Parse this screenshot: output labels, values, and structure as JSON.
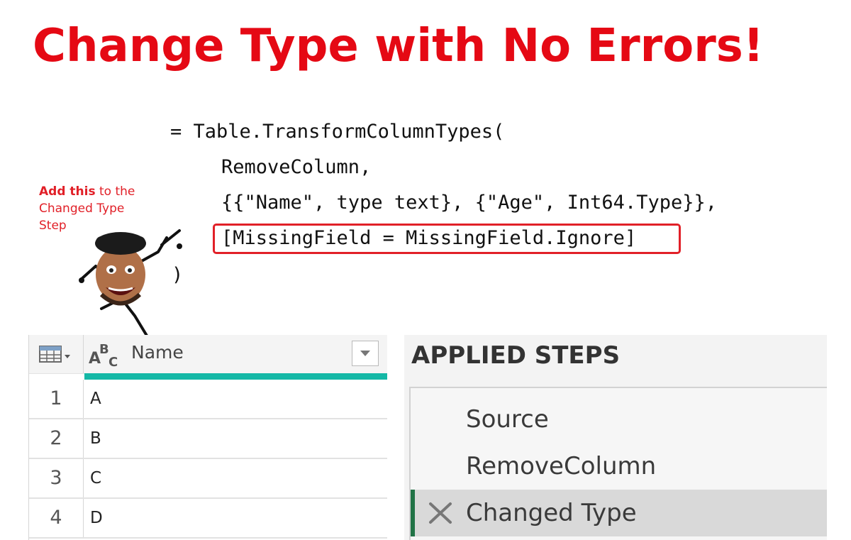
{
  "title": "Change Type with No Errors!",
  "code": {
    "line1": "= Table.TransformColumnTypes(",
    "line2": "RemoveColumn,",
    "line3": "{{\"Name\", type text}, {\"Age\", Int64.Type}},",
    "line4": "[MissingField = MissingField.Ignore]",
    "line5": ")"
  },
  "callout": {
    "bold": "Add this",
    "rest": " to the Changed Type Step"
  },
  "grid": {
    "column_header": "Name",
    "column_type_icon": "abc-text-type-icon",
    "rows": [
      {
        "num": "1",
        "value": "A"
      },
      {
        "num": "2",
        "value": "B"
      },
      {
        "num": "3",
        "value": "C"
      },
      {
        "num": "4",
        "value": "D"
      }
    ]
  },
  "applied_steps": {
    "heading": "APPLIED STEPS",
    "steps": [
      {
        "label": "Source"
      },
      {
        "label": "RemoveColumn"
      },
      {
        "label": "Changed Type",
        "selected": true
      }
    ]
  },
  "colors": {
    "title": "#e50914",
    "highlight_border": "#e12028",
    "quality_bar": "#14b8a6",
    "selected_step_bar": "#217346"
  }
}
